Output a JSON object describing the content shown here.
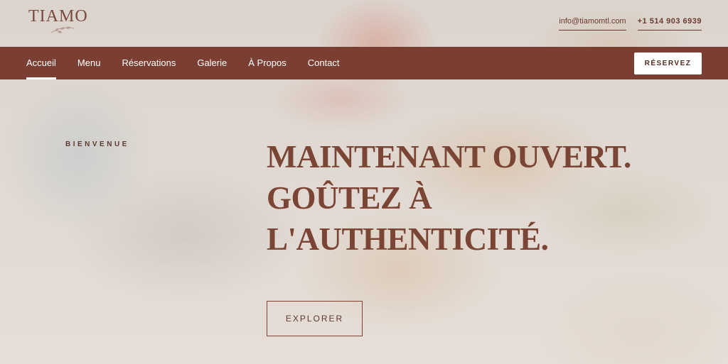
{
  "brand": {
    "logo_text": "TIAMO"
  },
  "contact": {
    "email": "info@tiamomtl.com",
    "phone": "+1 514 903 6939"
  },
  "nav": {
    "items": [
      {
        "label": "Accueil",
        "active": true
      },
      {
        "label": "Menu"
      },
      {
        "label": "Réservations"
      },
      {
        "label": "Galerie"
      },
      {
        "label": "À Propos"
      },
      {
        "label": "Contact"
      }
    ],
    "cta_label": "RÉSERVEZ"
  },
  "hero": {
    "eyebrow": "BIENVENUE",
    "headline_lines": [
      "MAINTENANT OUVERT.",
      "GOÛTEZ À",
      "L'AUTHENTICITÉ."
    ],
    "button_label": "EXPLORER"
  },
  "colors": {
    "nav_bg": "#7a3f32",
    "accent_text": "#7a4534",
    "button_bg": "#ffffff"
  }
}
